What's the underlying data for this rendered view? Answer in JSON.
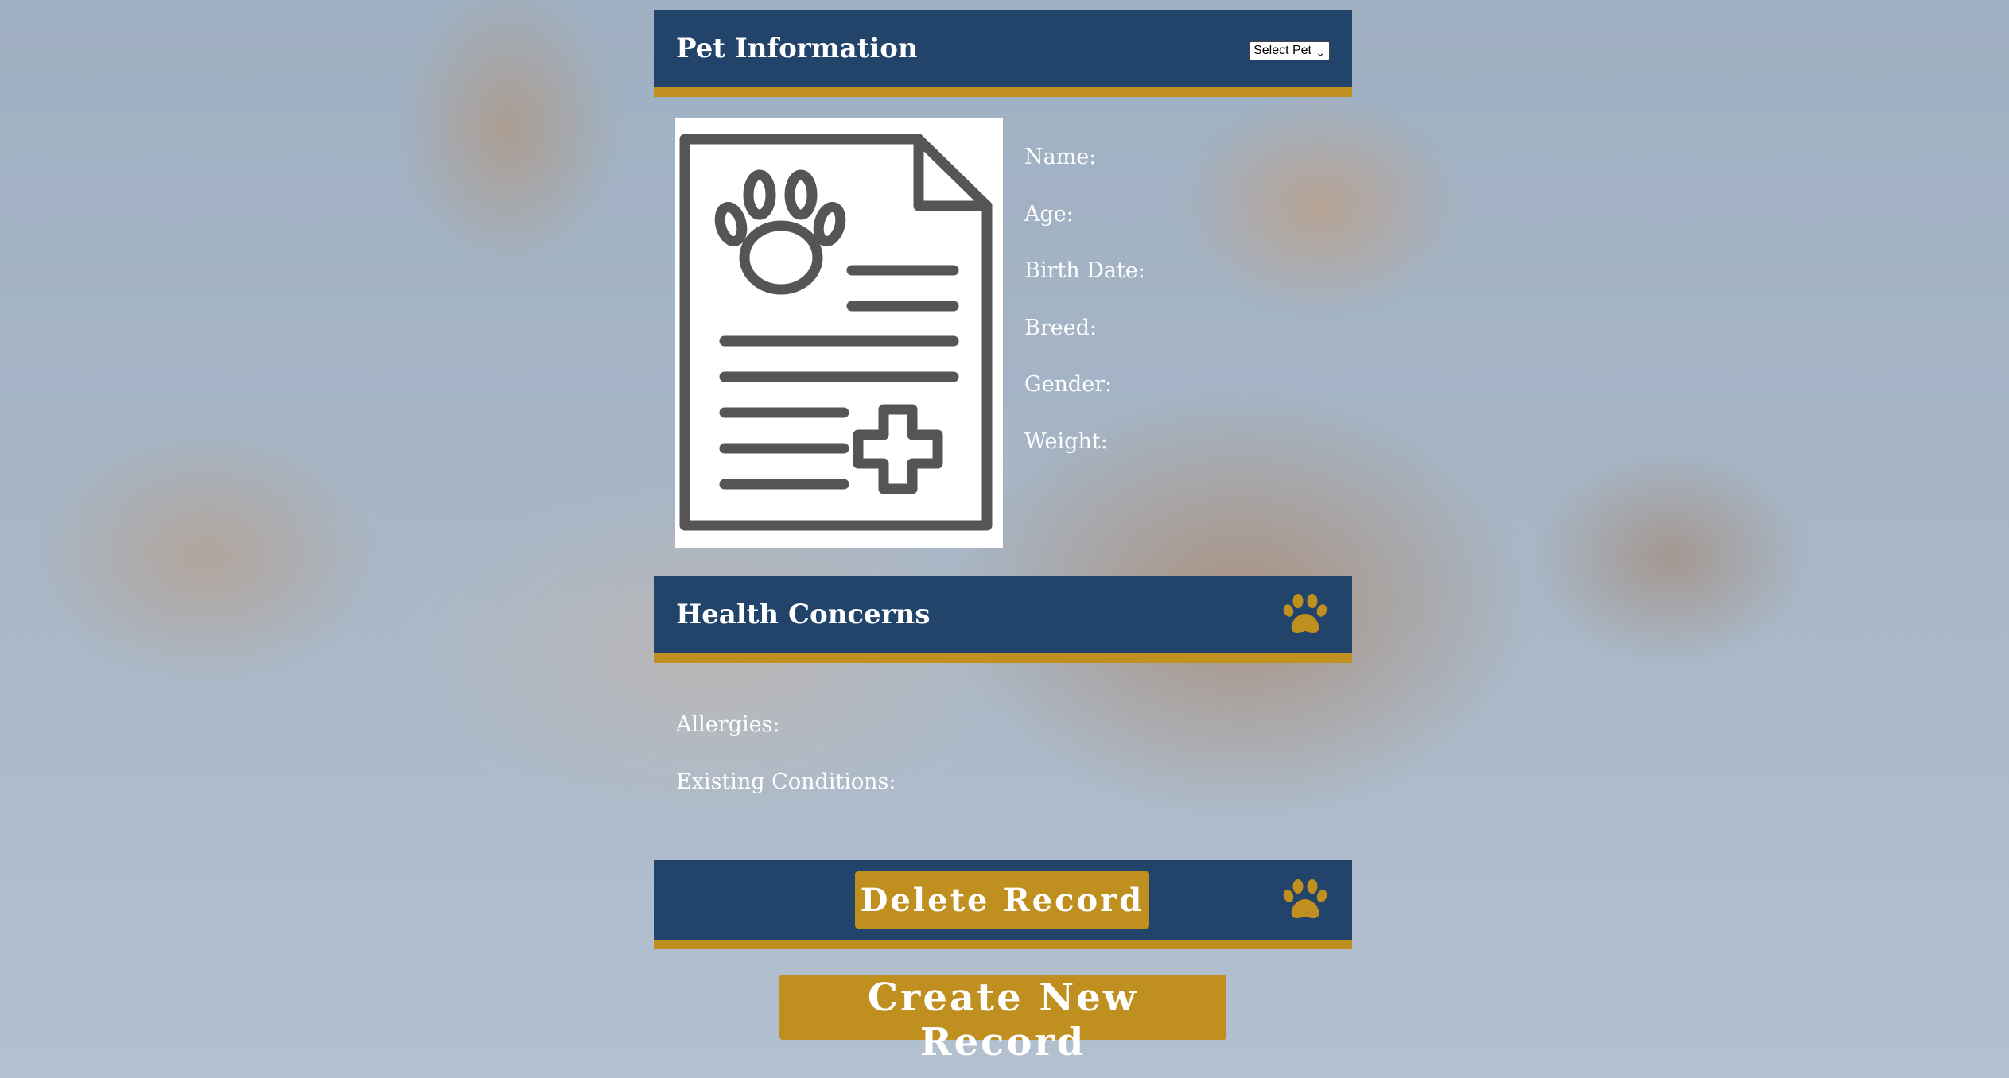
{
  "pet_info": {
    "title": "Pet Information",
    "select": {
      "selected": "Select Pet"
    },
    "fields": [
      {
        "label": "Name:"
      },
      {
        "label": "Age:"
      },
      {
        "label": "Birth Date:"
      },
      {
        "label": "Breed:"
      },
      {
        "label": "Gender:"
      },
      {
        "label": "Weight:"
      }
    ]
  },
  "health": {
    "title": "Health Concerns",
    "fields": [
      {
        "label": "Allergies:"
      },
      {
        "label": "Existing Conditions:"
      }
    ]
  },
  "actions": {
    "delete_label": "Delete Record",
    "create_label": "Create New Record"
  },
  "colors": {
    "header_bg": "#22436a",
    "accent_gold": "#bf8f1f",
    "text_white": "#ffffff"
  },
  "icons": {
    "header_icon": "paw-icon",
    "record_image": "pet-medical-record-icon"
  }
}
